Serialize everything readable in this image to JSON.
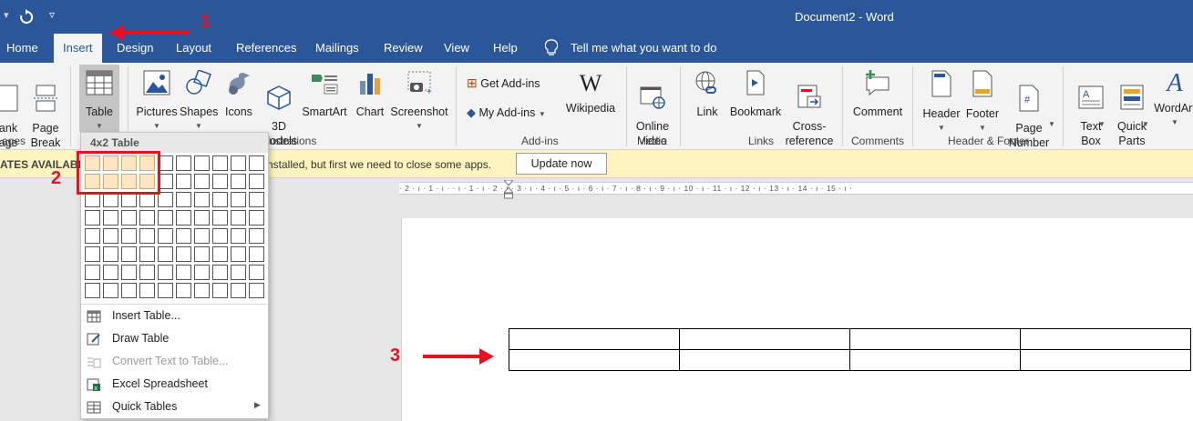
{
  "window": {
    "title": "Document2  -  Word",
    "qat": {
      "undo_icon": "undo-icon",
      "redo_icon": "redo-icon",
      "customize_icon": "customize-qat-icon"
    }
  },
  "tabs": [
    {
      "label": "Home"
    },
    {
      "label": "Insert",
      "active": true
    },
    {
      "label": "Design"
    },
    {
      "label": "Layout"
    },
    {
      "label": "References"
    },
    {
      "label": "Mailings"
    },
    {
      "label": "Review"
    },
    {
      "label": "View"
    },
    {
      "label": "Help"
    }
  ],
  "tell_me": {
    "label": "Tell me what you want to do",
    "icon": "lightbulb-icon"
  },
  "ribbon": {
    "pages": {
      "blank_page": "ank\nage",
      "page_break": "Page\nBreak",
      "group_label": "ages"
    },
    "tables": {
      "table_label": "Table"
    },
    "illustrations": {
      "pictures": "Pictures",
      "shapes": "Shapes",
      "icons": "Icons",
      "models": "3D\nModels",
      "smartart": "SmartArt",
      "chart": "Chart",
      "screenshot": "Screenshot",
      "group_label": "llustrations"
    },
    "addins": {
      "get_addins": "Get Add-ins",
      "my_addins": "My Add-ins",
      "wikipedia": "Wikipedia",
      "group_label": "Add-ins"
    },
    "media": {
      "online_video": "Online\nVideo",
      "group_label": "Media"
    },
    "links": {
      "link": "Link",
      "bookmark": "Bookmark",
      "cross_reference": "Cross-\nreference",
      "group_label": "Links"
    },
    "comments": {
      "comment": "Comment",
      "group_label": "Comments"
    },
    "header_footer": {
      "header": "Header",
      "footer": "Footer",
      "page_number": "Page\nNumber",
      "group_label": "Header & Footer"
    },
    "text": {
      "text_box": "Text\nBox",
      "quick_parts": "Quick\nParts",
      "wordart": "WordArt"
    }
  },
  "message_bar": {
    "title": "ATES AVAILABL",
    "text": "nstalled, but first we need to close some apps.",
    "button": "Update now"
  },
  "ruler": {
    "text": "· 2 · ı · 1 · ı ·   · ı · 1 · ı · 2 · ı · 3 · ı · 4 · ı · 5 · ı · 6 · ı · 7 · ı · 8 · ı · 9 · ı · 10 · ı · 11 · ı · 12 · ı · 13 · ı · 14 · ı · 15 · ı ·"
  },
  "table_dropdown": {
    "header": "4x2 Table",
    "grid": {
      "columns": 10,
      "rows": 8,
      "selected_columns": 4,
      "selected_rows": 2
    },
    "menu": [
      {
        "label": "Insert Table...",
        "icon": "insert-table-icon",
        "enabled": true
      },
      {
        "label": "Draw Table",
        "icon": "draw-table-icon",
        "enabled": true
      },
      {
        "label": "Convert Text to Table...",
        "icon": "convert-text-icon",
        "enabled": false
      },
      {
        "label": "Excel Spreadsheet",
        "icon": "excel-icon",
        "enabled": true
      },
      {
        "label": "Quick Tables",
        "icon": "quick-tables-icon",
        "enabled": true,
        "submenu": true
      }
    ]
  },
  "document_table": {
    "columns": 4,
    "rows": 2
  },
  "annotations": {
    "step1": "1",
    "step2": "2",
    "step3": "3",
    "color": "#e81123"
  },
  "colors": {
    "accent": "#2b579a",
    "message_bar": "#fdf4bf",
    "grid_selected": "#fde6c4"
  }
}
